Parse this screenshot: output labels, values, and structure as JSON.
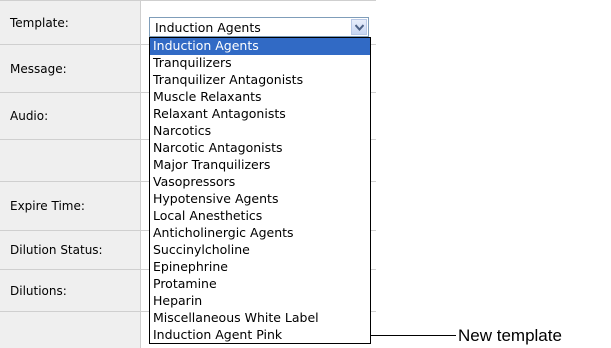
{
  "form": {
    "rows": [
      {
        "label": "Template:"
      },
      {
        "label": "Message:"
      },
      {
        "label": "Audio:"
      },
      {
        "label": ""
      },
      {
        "label": "Expire Time:"
      },
      {
        "label": "Dilution Status:"
      },
      {
        "label": "Dilutions:"
      },
      {
        "label": ""
      }
    ]
  },
  "template_select": {
    "selected_value": "Induction Agents",
    "options": [
      "Induction Agents",
      "Tranquilizers",
      "Tranquilizer Antagonists",
      "Muscle Relaxants",
      "Relaxant Antagonists",
      "Narcotics",
      "Narcotic Antagonists",
      "Major Tranquilizers",
      "Vasopressors",
      "Hypotensive Agents",
      "Local Anesthetics",
      "Anticholinergic Agents",
      "Succinylcholine",
      "Epinephrine",
      "Protamine",
      "Heparin",
      "Miscellaneous White Label",
      "Induction Agent Pink"
    ],
    "highlighted_index": 0
  },
  "annotation": {
    "text": "New template"
  },
  "colors": {
    "highlight": "#316ac5",
    "label_bg": "#efefef",
    "grid_line": "#cfcfcf"
  }
}
